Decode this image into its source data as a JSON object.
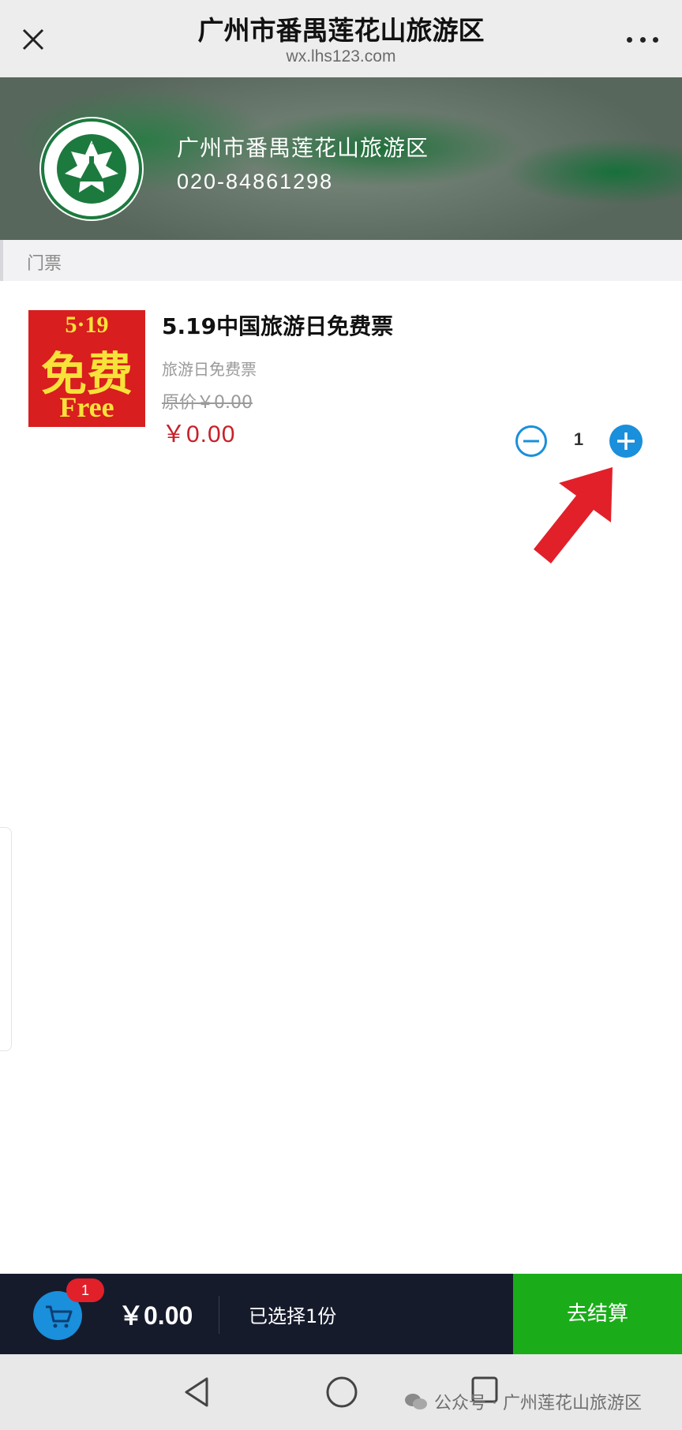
{
  "titlebar": {
    "title": "广州市番禺莲花山旅游区",
    "subtitle": "wx.lhs123.com",
    "close_icon": "close-icon",
    "more_icon": "more-icon"
  },
  "shop": {
    "logo": "lotus-resort-logo",
    "name": "广州市番禺莲花山旅游区",
    "phone": "020-84861298"
  },
  "category": {
    "label": "门票"
  },
  "product": {
    "image": {
      "top": "5·19",
      "middle": "免费",
      "bottom": "Free"
    },
    "title": "5.19中国旅游日免费票",
    "subtitle": "旅游日免费票",
    "original_price": "原价￥0.00",
    "price": "￥0.00",
    "quantity": "1"
  },
  "cart": {
    "badge": "1",
    "total": "￥0.00",
    "selected": "已选择1份",
    "checkout": "去结算"
  },
  "watermark": {
    "text": "公众号 · 广州莲花山旅游区"
  },
  "colors": {
    "price_red": "#c8202a",
    "checkout_green": "#1aad19",
    "cart_bar": "#161b2c",
    "stepper_blue": "#1a8fdb"
  }
}
